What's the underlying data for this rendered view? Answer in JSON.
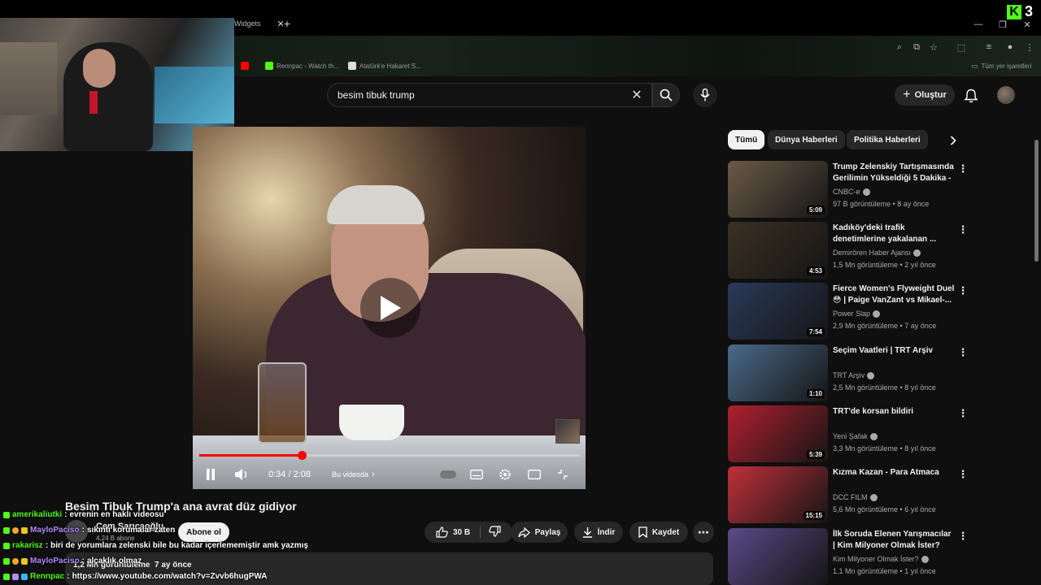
{
  "browser": {
    "active_tab_label": "Widgets",
    "bookmarks": [
      {
        "label": "Rennpac - Watch th...",
        "color": "#53fc18"
      },
      {
        "label": "Atatürk'e Hakaret S...",
        "color": "#dddddd"
      }
    ],
    "all_bookmarks_label": "Tüm yer işaretleri"
  },
  "kick": {
    "logo": "K",
    "count": "3"
  },
  "search": {
    "query": "besim tibuk trump"
  },
  "header": {
    "create_label": "Oluştur"
  },
  "player": {
    "current_time": "0:34",
    "duration": "2:08",
    "progress": 0.27,
    "chapter_label": "Bu videoda"
  },
  "video": {
    "title": "Besim Tibuk Trump'a ana avrat düz gidiyor",
    "channel": "Cem Sarıcaoğlu",
    "subscribers": "4,24 B abone",
    "subscribe_label": "Abone ol",
    "likes": "30 B",
    "share_label": "Paylaş",
    "download_label": "İndir",
    "save_label": "Kaydet",
    "views": "1,2 Mn görüntüleme",
    "age": "7 ay önce"
  },
  "chat": [
    {
      "user": "amerikaliutki",
      "message": "evrenin en haklı videosu",
      "color": "green"
    },
    {
      "user": "MayloPaciso",
      "message": "sıkıntı korumalar zaten",
      "color": "purple"
    },
    {
      "user": "rakarisz",
      "message": "biri de yorumlara zelenski bile bu kadar içerlememiştir amk yazmış",
      "color": "green"
    },
    {
      "user": "MayloPaciso",
      "message": "alçaklık olmaz",
      "color": "purple"
    },
    {
      "user": "Rennpac",
      "message": "https://www.youtube.com/watch?v=Zvvb6hugPWA",
      "color": "green"
    }
  ],
  "chips": [
    "Tümü",
    "Dünya Haberleri",
    "Politika Haberleri"
  ],
  "recommendations": [
    {
      "title": "Trump Zelenskiy Tartışmasında Gerilimin Yükseldiği 5 Dakika - ...",
      "channel": "CNBC-e",
      "views": "97 B görüntüleme",
      "age": "8 ay önce",
      "duration": "5:09",
      "thumb_color": "#6b5a48"
    },
    {
      "title": "Kadıköy'deki trafik denetimlerine yakalanan ...",
      "channel": "Demirören Haber Ajansı",
      "views": "1,5 Mn görüntüleme",
      "age": "2 yıl önce",
      "duration": "4:53",
      "thumb_color": "#3b3022"
    },
    {
      "title": "Fierce Women's Flyweight Duel 😳 | Paige VanZant vs Mikael-...",
      "channel": "Power Slap",
      "views": "2,9 Mn görüntüleme",
      "age": "7 ay önce",
      "duration": "7:54",
      "thumb_color": "#2a3a5a"
    },
    {
      "title": "Seçim Vaatleri | TRT Arşiv",
      "channel": "TRT Arşiv",
      "views": "2,5 Mn görüntüleme",
      "age": "8 yıl önce",
      "duration": "1:10",
      "thumb_color": "#4a6a8a"
    },
    {
      "title": "TRT'de korsan bildiri",
      "channel": "Yeni Şafak",
      "views": "3,3 Mn görüntüleme",
      "age": "8 yıl önce",
      "duration": "5:39",
      "thumb_color": "#b02030"
    },
    {
      "title": "Kızma Kazan - Para Atmaca",
      "channel": "DCC FILM",
      "views": "5,6 Mn görüntüleme",
      "age": "6 yıl önce",
      "duration": "15:15",
      "thumb_color": "#c0303a"
    },
    {
      "title": "İlk Soruda Elenen Yarışmacılar | Kim Milyoner Olmak İster?",
      "channel": "Kim Milyoner Olmak İster?",
      "views": "1,1 Mn görüntüleme",
      "age": "1 yıl önce",
      "duration": "",
      "thumb_color": "#5a4a8a"
    }
  ],
  "colors": {
    "accent": "#ff0000",
    "kick_green": "#53fc18",
    "background": "#0f0f0f"
  }
}
